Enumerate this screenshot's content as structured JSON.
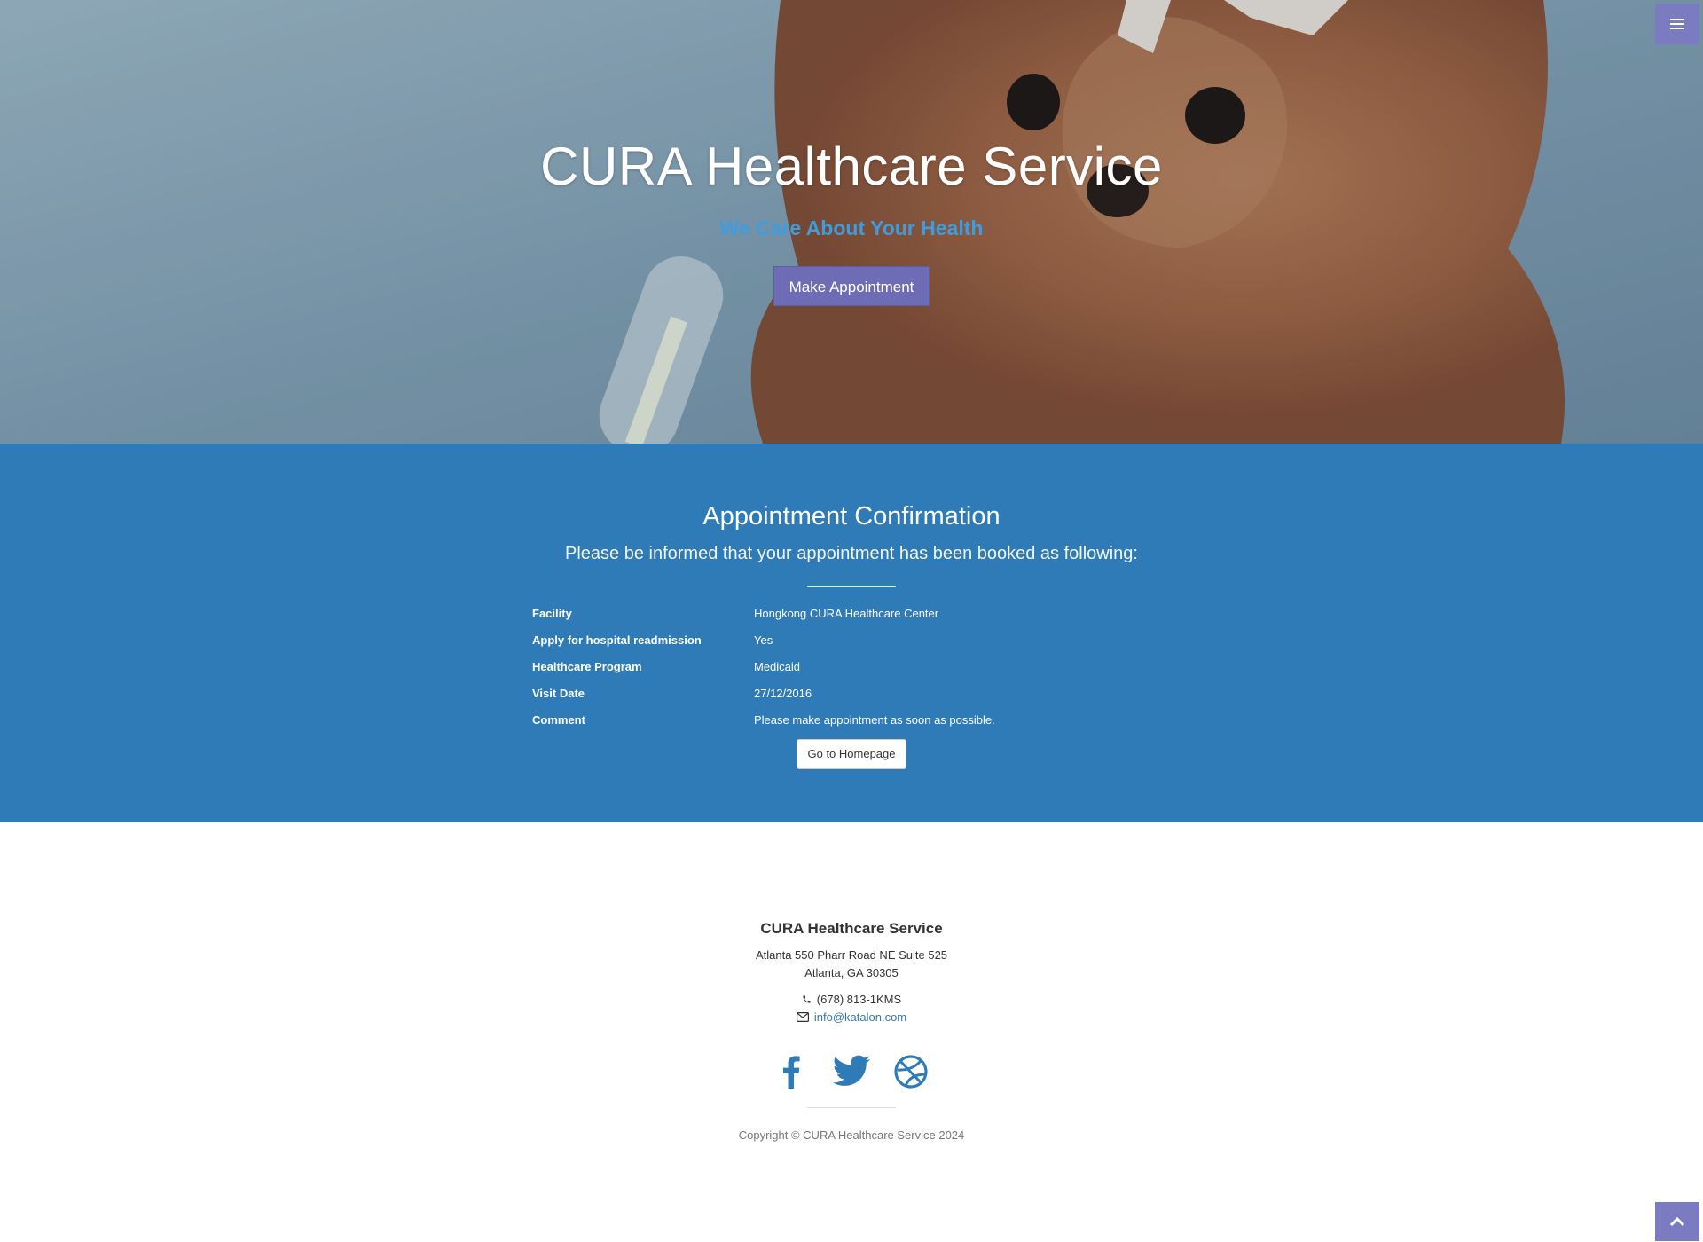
{
  "hero": {
    "title": "CURA Healthcare Service",
    "subtitle": "We Care About Your Health",
    "button_label": "Make Appointment"
  },
  "menu": {
    "icon": "hamburger-menu-icon"
  },
  "confirmation": {
    "title": "Appointment Confirmation",
    "lead": "Please be informed that your appointment has been booked as following:",
    "details": [
      {
        "label": "Facility",
        "value": "Hongkong CURA Healthcare Center"
      },
      {
        "label": "Apply for hospital readmission",
        "value": "Yes"
      },
      {
        "label": "Healthcare Program",
        "value": "Medicaid"
      },
      {
        "label": "Visit Date",
        "value": "27/12/2016"
      },
      {
        "label": "Comment",
        "value": "Please make appointment as soon as possible."
      }
    ],
    "home_button_label": "Go to Homepage"
  },
  "footer": {
    "title": "CURA Healthcare Service",
    "address_line1": "Atlanta 550 Pharr Road NE Suite 525",
    "address_line2": "Atlanta, GA 30305",
    "phone": "(678) 813-1KMS",
    "email": "info@katalon.com",
    "social": [
      "facebook-icon",
      "twitter-icon",
      "dribbble-icon"
    ],
    "copyright": "Copyright © CURA Healthcare Service 2024"
  },
  "scroll_top": {
    "icon": "chevron-up-icon"
  },
  "colors": {
    "primary_blue": "#2f7bb7",
    "button_purple": "#6e6cb5",
    "subtitle_blue": "#3d9de0",
    "link_blue": "#337ab7"
  }
}
